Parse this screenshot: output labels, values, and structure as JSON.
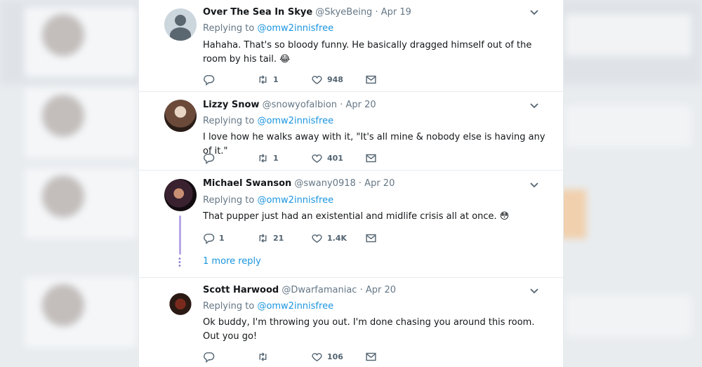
{
  "tweets": [
    {
      "name": "Over The Sea In Skye",
      "handle": "@SkyeBeing",
      "date": "· Apr 19",
      "replying_prefix": "Replying to ",
      "replying_to": "@omw2innisfree",
      "text": "Hahaha. That's so bloody funny. He basically dragged himself out of the room by his tail. 😂",
      "reply_count": "",
      "retweet_count": "1",
      "like_count": "948"
    },
    {
      "name": "Lizzy Snow",
      "handle": "@snowyofalbion",
      "date": "· Apr 20",
      "replying_prefix": "Replying to ",
      "replying_to": "@omw2innisfree",
      "text": "I love how he walks away with it, \"It's all mine & nobody else is having any of it.\"",
      "reply_count": "",
      "retweet_count": "1",
      "like_count": "401"
    },
    {
      "name": "Michael Swanson",
      "handle": "@swany0918",
      "date": "· Apr 20",
      "replying_prefix": "Replying to ",
      "replying_to": "@omw2innisfree",
      "text": "That pupper just had an existential and midlife crisis all at once. 😳",
      "reply_count": "1",
      "retweet_count": "21",
      "like_count": "1.4K",
      "more_replies": "1 more reply"
    },
    {
      "name": "Scott Harwood",
      "handle": "@Dwarfamaniac",
      "date": "· Apr 20",
      "replying_prefix": "Replying to ",
      "replying_to": "@omw2innisfree",
      "text": "Ok buddy, I'm throwing you out. I'm done chasing you around this room. Out you go!",
      "reply_count": "",
      "retweet_count": "",
      "like_count": "106"
    }
  ],
  "icons": {
    "reply": "reply-icon",
    "retweet": "retweet-icon",
    "like": "heart-icon",
    "dm": "envelope-icon",
    "caret": "chevron-down-icon"
  },
  "colors": {
    "link": "#1b95e0",
    "muted": "#657786",
    "text": "#14171a",
    "thread": "#b7a8e8"
  }
}
